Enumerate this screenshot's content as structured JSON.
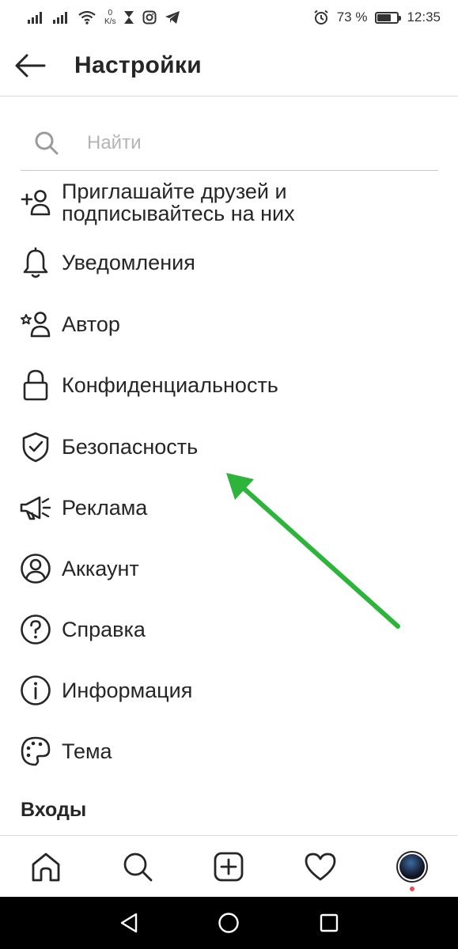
{
  "status_bar": {
    "net_speed_value": "0",
    "net_speed_unit": "K/s",
    "battery_percent": "73 %",
    "battery_level": 0.73,
    "time": "12:35"
  },
  "header": {
    "title": "Настройки"
  },
  "search": {
    "placeholder": "Найти"
  },
  "menu": {
    "items": [
      {
        "label_line1": "Приглашайте друзей и",
        "label_line2": "подписывайтесь на них",
        "icon": "add-person-icon"
      },
      {
        "label": "Уведомления",
        "icon": "bell-icon"
      },
      {
        "label": "Автор",
        "icon": "star-person-icon"
      },
      {
        "label": "Конфиденциальность",
        "icon": "lock-icon"
      },
      {
        "label": "Безопасность",
        "icon": "shield-check-icon"
      },
      {
        "label": "Реклама",
        "icon": "megaphone-icon"
      },
      {
        "label": "Аккаунт",
        "icon": "account-circle-icon"
      },
      {
        "label": "Справка",
        "icon": "help-circle-icon"
      },
      {
        "label": "Информация",
        "icon": "info-circle-icon"
      },
      {
        "label": "Тема",
        "icon": "palette-icon"
      }
    ]
  },
  "section": {
    "logins_title": "Входы"
  },
  "bottom_nav": {
    "items": [
      "home-icon",
      "search-icon",
      "add-post-icon",
      "heart-icon",
      "profile-avatar"
    ]
  },
  "colors": {
    "text": "#262626",
    "divider": "#dbdbdb",
    "placeholder": "#b4b4b4",
    "annotation_arrow": "#2db43a",
    "notification_dot": "#ed4956"
  }
}
